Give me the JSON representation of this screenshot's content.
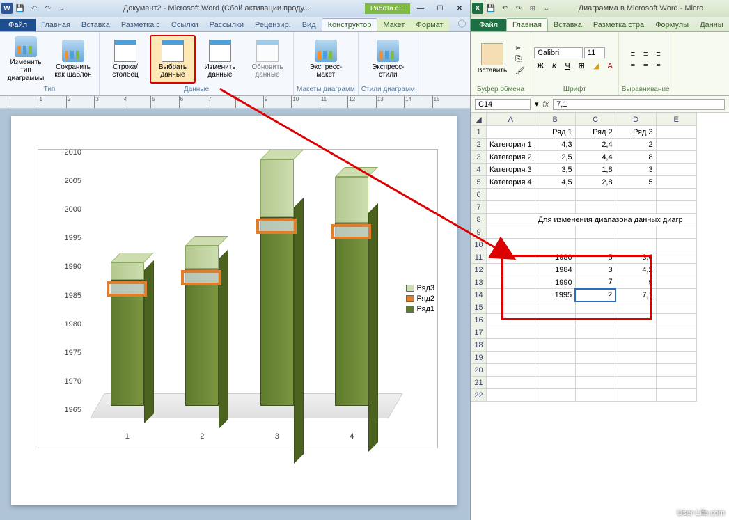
{
  "word": {
    "title": "Документ2 - Microsoft Word (Сбой активации проду...",
    "contextual_title": "Работа с...",
    "qat": [
      "💾",
      "↶",
      "↷",
      "⌄"
    ],
    "win": [
      "—",
      "☐",
      "✕"
    ],
    "file_tab": "Файл",
    "tabs": [
      "Главная",
      "Вставка",
      "Разметка с",
      "Ссылки",
      "Рассылки",
      "Рецензир.",
      "Вид"
    ],
    "ctx_tabs": [
      "Конструктор",
      "Макет",
      "Формат"
    ],
    "ribbon": {
      "g1": {
        "label": "Тип",
        "btn1": "Изменить тип диаграммы",
        "btn2": "Сохранить как шаблон"
      },
      "g2": {
        "label": "Данные",
        "btn1": "Строка/столбец",
        "btn2": "Выбрать данные",
        "btn3": "Изменить данные",
        "btn4": "Обновить данные"
      },
      "g3": {
        "label": "Макеты диаграмм",
        "btn": "Экспресс-макет"
      },
      "g4": {
        "label": "Стили диаграмм",
        "btn": "Экспресс-стили"
      }
    },
    "ruler_cm": [
      "",
      "1",
      "2",
      "3",
      "4",
      "5",
      "6",
      "7",
      "8",
      "9",
      "10",
      "11",
      "12",
      "13",
      "14",
      "15"
    ]
  },
  "excel": {
    "title": "Диаграмма в Microsoft Word - Micro",
    "file_tab": "Файл",
    "tabs": [
      "Главная",
      "Вставка",
      "Разметка стра",
      "Формулы",
      "Данны"
    ],
    "ribbon": {
      "clipboard": {
        "label": "Буфер обмена",
        "paste": "Вставить"
      },
      "font": {
        "label": "Шрифт",
        "name": "Calibri",
        "size": "11",
        "bold": "Ж",
        "italic": "К",
        "underline": "Ч"
      },
      "align": {
        "label": "Выравнивание"
      }
    },
    "name_box": "C14",
    "formula": "7,1",
    "cols": [
      "A",
      "B",
      "C",
      "D",
      "E"
    ],
    "rows": {
      "1": [
        "",
        "Ряд 1",
        "Ряд 2",
        "Ряд 3",
        ""
      ],
      "2": [
        "Категория 1",
        "4,3",
        "2,4",
        "2",
        ""
      ],
      "3": [
        "Категория 2",
        "2,5",
        "4,4",
        "8",
        ""
      ],
      "4": [
        "Категория 3",
        "3,5",
        "1,8",
        "3",
        ""
      ],
      "5": [
        "Категория 4",
        "4,5",
        "2,8",
        "5",
        ""
      ],
      "8_note": "Для изменения диапазона данных диагр",
      "11": [
        "",
        "1980",
        "5",
        "3,6",
        ""
      ],
      "12": [
        "",
        "1984",
        "3",
        "4,2",
        ""
      ],
      "13": [
        "",
        "1990",
        "7",
        "9",
        ""
      ],
      "14": [
        "",
        "1995",
        "2",
        "7,1",
        ""
      ]
    }
  },
  "chart_data": {
    "type": "bar",
    "categories": [
      "1",
      "2",
      "3",
      "4"
    ],
    "series": [
      {
        "name": "Ряд1",
        "values": [
          1987,
          1989,
          1998,
          1997
        ],
        "color": "#5e7a2e"
      },
      {
        "name": "Ряд2",
        "values": [
          1990,
          1992,
          2005,
          2001
        ],
        "color": "#e07e2c"
      },
      {
        "name": "Ряд3",
        "values": [
          1990,
          1993,
          2008,
          2005
        ],
        "color": "#cdddb0"
      }
    ],
    "y_ticks": [
      1965,
      1970,
      1975,
      1980,
      1985,
      1990,
      1995,
      2000,
      2005,
      2010
    ],
    "ylim": [
      1965,
      2010
    ],
    "xlabel": "",
    "ylabel": "",
    "legend": [
      "Ряд3",
      "Ряд2",
      "Ряд1"
    ]
  },
  "watermark": "User-Life.com"
}
